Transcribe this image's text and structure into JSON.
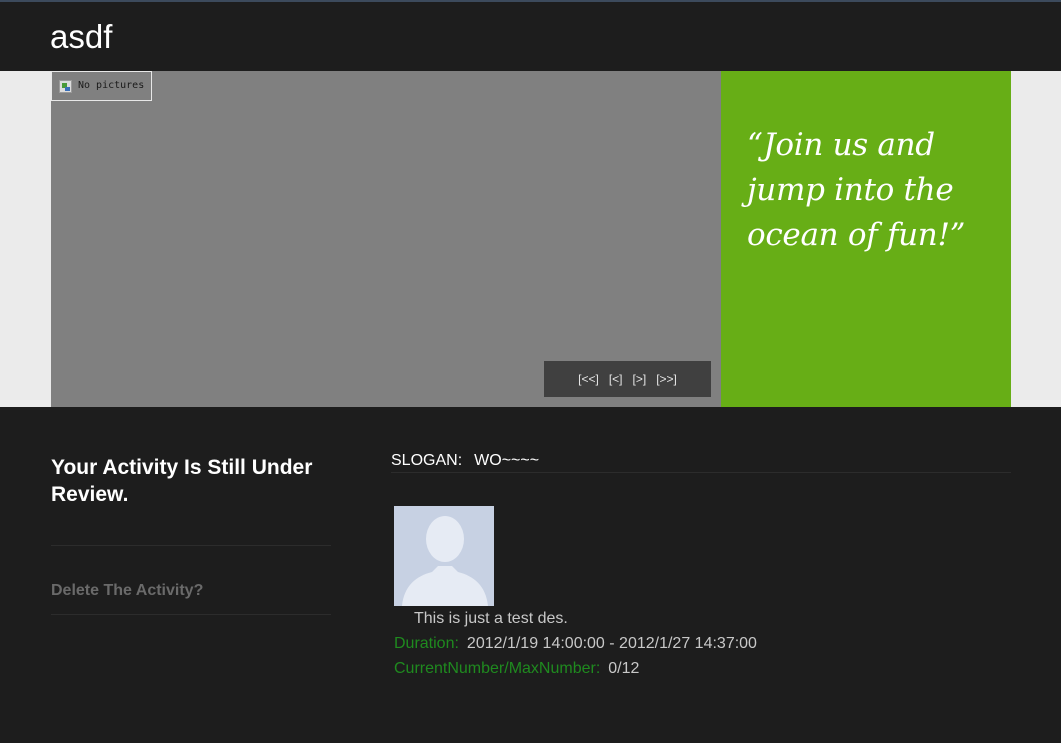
{
  "header": {
    "title": "asdf"
  },
  "slider": {
    "no_picture_text": "No pictures",
    "pager": {
      "first": "[<<]",
      "prev": "[<]",
      "next": "[>]",
      "last": "[>>]"
    }
  },
  "promo": {
    "quote": "“Join us and jump into the ocean of fun!”"
  },
  "sidebar": {
    "review_status": "Your Activity Is Still Under Review.",
    "delete_link": "Delete The Activity?"
  },
  "activity": {
    "slogan_label": "SLOGAN:",
    "slogan_value": "WO~~~~",
    "description": "This is just a test des.",
    "duration_label": "Duration:",
    "duration_value": "2012/1/19 14:00:00 - 2012/1/27 14:37:00",
    "number_label": "CurrentNumber/MaxNumber:",
    "number_value": "0/12"
  },
  "colors": {
    "background": "#1d1d1d",
    "promo_green": "#67ae16",
    "label_green": "#1f8a1f"
  },
  "icons": [
    "broken-image-icon",
    "default-avatar-icon"
  ]
}
